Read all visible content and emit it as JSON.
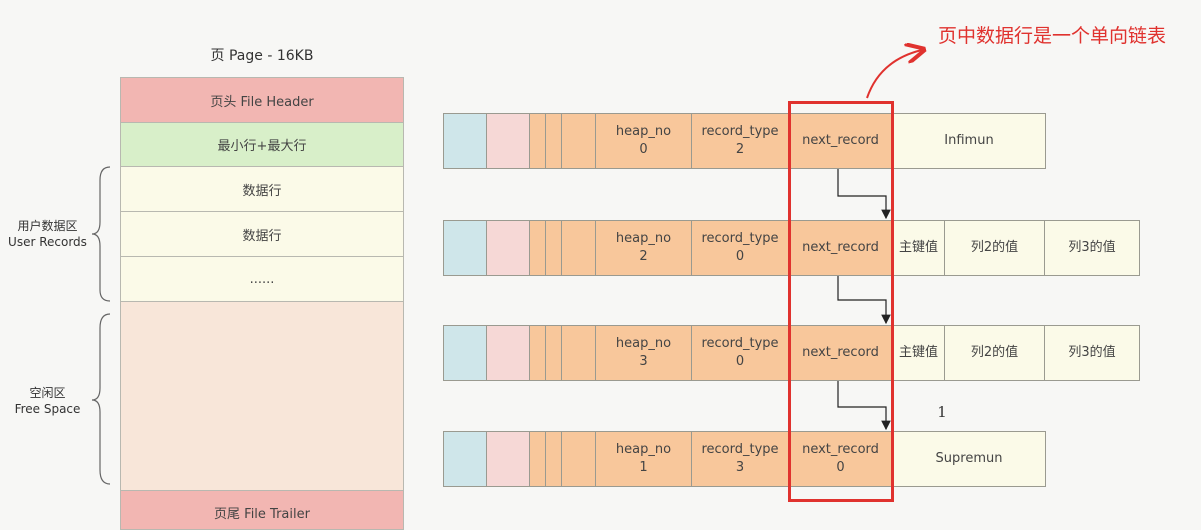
{
  "page": {
    "title": "页 Page - 16KB",
    "file_header": "页头 File Header",
    "min_max": "最小行+最大行",
    "data_row_1": "数据行",
    "data_row_2": "数据行",
    "ellipsis": "......",
    "file_trailer": "页尾 File Trailer",
    "user_records_cn": "用户数据区",
    "user_records_en": "User Records",
    "free_space_cn": "空闲区",
    "free_space_en": "Free Space"
  },
  "records": [
    {
      "heap_label": "heap_no",
      "heap_value": "0",
      "type_label": "record_type",
      "type_value": "2",
      "next_label": "next_record",
      "next_value": "",
      "name": "Infimun"
    },
    {
      "heap_label": "heap_no",
      "heap_value": "2",
      "type_label": "record_type",
      "type_value": "0",
      "next_label": "next_record",
      "next_value": "",
      "col1": "主键值",
      "col2": "列2的值",
      "col3": "列3的值"
    },
    {
      "heap_label": "heap_no",
      "heap_value": "3",
      "type_label": "record_type",
      "type_value": "0",
      "next_label": "next_record",
      "next_value": "",
      "col1": "主键值",
      "col2": "列2的值",
      "col3": "列3的值"
    },
    {
      "heap_label": "heap_no",
      "heap_value": "1",
      "type_label": "record_type",
      "type_value": "3",
      "next_label": "next_record",
      "next_value": "0",
      "name": "Supremun"
    }
  ],
  "annotation": "页中数据行是一个单向链表",
  "stray_mark": "1",
  "colors": {
    "highlight": "#e0322e",
    "header": "#f2b6b2",
    "minmax": "#d8efc9",
    "row": "#fbfae8",
    "free": "#f8e6d9",
    "record_orange": "#f8c79b",
    "record_blue": "#cfe6ea",
    "record_pink": "#f6d8d6"
  }
}
